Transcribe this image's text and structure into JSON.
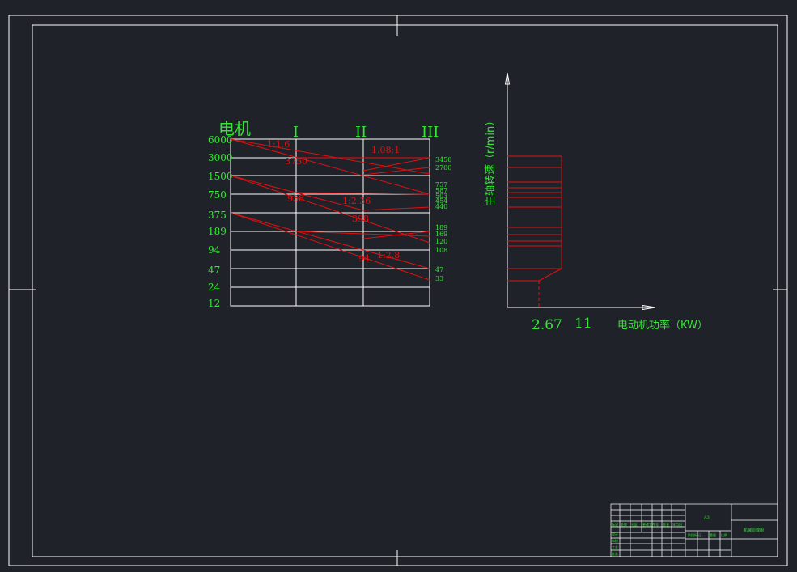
{
  "colors": {
    "background": "#1f2329",
    "frame": "#ffffff",
    "text_green": "#35e635",
    "line_red": "#e01010",
    "grid": "#ffffff"
  },
  "speed_diagram": {
    "motor_label": "电机",
    "shaft_labels": [
      "I",
      "II",
      "III"
    ],
    "speed_levels": [
      "6000",
      "3000",
      "1500",
      "750",
      "375",
      "189",
      "94",
      "47",
      "24",
      "12"
    ],
    "ratios": [
      "1:1.6",
      "1.08:1",
      "1:2.36",
      "1:2.8"
    ],
    "red_values": [
      "3750",
      "938",
      "398",
      "94"
    ],
    "output_speeds": [
      "3450",
      "2700",
      "757",
      "587",
      "503",
      "454",
      "440",
      "189",
      "169",
      "120",
      "108",
      "47",
      "33"
    ]
  },
  "power_chart": {
    "ylabel": "主轴转速（r/min）",
    "xlabel": "电动机功率（KW）",
    "x_values": [
      "2.67",
      "11"
    ]
  },
  "title_block": {
    "label_a": "机械原理图",
    "label_b": "A3",
    "headers": [
      "标记",
      "处数",
      "分区",
      "更改文件号",
      "签名",
      "年月日"
    ],
    "roles": [
      "设计",
      "审核",
      "工艺",
      "批准"
    ],
    "fields": [
      "阶段标记",
      "重量",
      "比例"
    ]
  }
}
